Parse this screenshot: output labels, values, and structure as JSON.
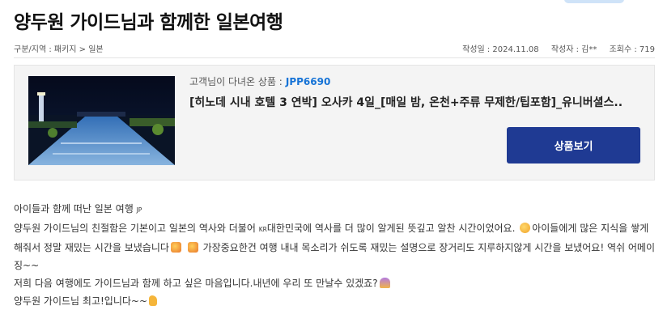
{
  "page": {
    "title": "양두원 가이드님과 함께한 일본여행",
    "breadcrumb": "구분/지역 : 패키지 > 일본",
    "meta": {
      "date_label": "작성일 : 2024.11.08",
      "author_label": "작성자 : 김**",
      "views_label": "조회수 : 719"
    }
  },
  "product": {
    "code_label": "고객님이 다녀온 상품 :",
    "code": "JPP6690",
    "title": "[히노데 시내 호텔 3 연박] 오사카 4일_[매일 밤, 온천+주류 무제한/팁포함]_유니버셜스..",
    "button_label": "상품보기",
    "button_color": "#1f3a93",
    "code_color": "#1673d6"
  },
  "review": {
    "line1_text": "아이들과 함께 떠난 일본 여행",
    "line1_flag": "JP",
    "line2_a": "양두원 가이드님의 친절함은 기본이고 일본의 역사와 더불어",
    "line2_flag": "KR",
    "line2_b": "대한민국에 역사를 더 많이 알게된 뜻깊고 알찬 시간이었어요.",
    "line2_c": "아이들에게 많은 지식을 쌓게 해줘서 정말 재밌는 시간을 보냈습니다",
    "line2_d": "가장중요한건 여행 내내 목소리가 쉬도록 재밌는 설명으로 장거리도 지루하지않게 시간을 보냈어요! 역쉬 어메이징~~",
    "line3": "저희 다음 여행에도 가이드님과 함께 하고 싶은 마음입니다.내년에 우리 또 만날수 있겠죠?",
    "line4": "양두원 가이드님 최고!입니다~~",
    "emoji": [
      "nerd-face-emoji",
      "party-popper-emoji",
      "party-popper-emoji",
      "folded-hands-emoji",
      "thumbs-up-emoji"
    ]
  }
}
